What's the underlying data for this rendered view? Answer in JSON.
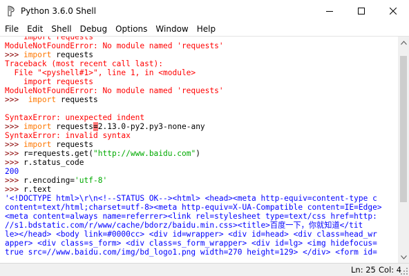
{
  "window": {
    "title": "Python 3.6.0 Shell",
    "icon": "idle-feather-icon"
  },
  "menu": [
    "File",
    "Edit",
    "Shell",
    "Debug",
    "Options",
    "Window",
    "Help"
  ],
  "colors": {
    "error": "#ff0000",
    "keyword": "#ff7700",
    "prompt": "#8b0000",
    "output": "#0000ff",
    "string": "#00aa00",
    "error_highlight": "#ff7777"
  },
  "shell_lines": [
    [
      {
        "t": "    ",
        "c": "black"
      },
      {
        "t": "import",
        "c": "err"
      },
      {
        "t": " requests",
        "c": "err"
      }
    ],
    [
      {
        "t": "ModuleNotFoundError: No module named 'requests'",
        "c": "err"
      }
    ],
    [
      {
        "t": ">>> ",
        "c": "prompt"
      },
      {
        "t": "import",
        "c": "kw"
      },
      {
        "t": " requests",
        "c": "black"
      }
    ],
    [
      {
        "t": "Traceback (most recent call last):",
        "c": "err"
      }
    ],
    [
      {
        "t": "  File \"<pyshell#1>\", line 1, in <module>",
        "c": "err"
      }
    ],
    [
      {
        "t": "    import requests",
        "c": "err"
      }
    ],
    [
      {
        "t": "ModuleNotFoundError: No module named 'requests'",
        "c": "err"
      }
    ],
    [
      {
        "t": ">>>  ",
        "c": "prompt"
      },
      {
        "t": "import",
        "c": "kw"
      },
      {
        "t": " requests",
        "c": "black"
      }
    ],
    [
      {
        "t": "",
        "c": "black"
      }
    ],
    [
      {
        "t": "SyntaxError: unexpected indent",
        "c": "err"
      }
    ],
    [
      {
        "t": ">>> ",
        "c": "prompt"
      },
      {
        "t": "import",
        "c": "kw"
      },
      {
        "t": " requests",
        "c": "black"
      },
      {
        "t": "=",
        "c": "hl"
      },
      {
        "t": "2.13.0-py2.py3-none-any",
        "c": "black"
      }
    ],
    [
      {
        "t": "SyntaxError: invalid syntax",
        "c": "err"
      }
    ],
    [
      {
        "t": ">>> ",
        "c": "prompt"
      },
      {
        "t": "import",
        "c": "kw"
      },
      {
        "t": " requests",
        "c": "black"
      }
    ],
    [
      {
        "t": ">>> ",
        "c": "prompt"
      },
      {
        "t": "r=requests.get(",
        "c": "black"
      },
      {
        "t": "\"http://www.baidu.com\"",
        "c": "str"
      },
      {
        "t": ")",
        "c": "black"
      }
    ],
    [
      {
        "t": ">>> ",
        "c": "prompt"
      },
      {
        "t": "r.status_code",
        "c": "black"
      }
    ],
    [
      {
        "t": "200",
        "c": "out"
      }
    ],
    [
      {
        "t": ">>> ",
        "c": "prompt"
      },
      {
        "t": "r.encoding=",
        "c": "black"
      },
      {
        "t": "'utf-8'",
        "c": "str"
      }
    ],
    [
      {
        "t": ">>> ",
        "c": "prompt"
      },
      {
        "t": "r.text",
        "c": "black"
      }
    ],
    [
      {
        "t": "'<!DOCTYPE html>\\r\\n<!--STATUS OK--><html> <head><meta http-equiv=content-type c",
        "c": "out"
      }
    ],
    [
      {
        "t": "content=text/html;charset=utf-8><meta http-equiv=X-UA-Compatible content=IE=Edge>",
        "c": "out"
      }
    ],
    [
      {
        "t": "<meta content=always name=referrer><link rel=stylesheet type=text/css href=http:",
        "c": "out"
      }
    ],
    [
      {
        "t": "//s1.bdstatic.com/r/www/cache/bdorz/baidu.min.css><title>百度一下，你就知道</tit",
        "c": "out"
      }
    ],
    [
      {
        "t": "le></head> <body link=#0000cc> <div id=wrapper> <div id=head> <div class=head_wr",
        "c": "out"
      }
    ],
    [
      {
        "t": "apper> <div class=s_form> <div class=s_form_wrapper> <div id=lg> <img hidefocus=",
        "c": "out"
      }
    ],
    [
      {
        "t": "true src=//www.baidu.com/img/bd_logo1.png width=270 height=129> </div> <form id=",
        "c": "out"
      }
    ]
  ],
  "status": {
    "ln": "Ln: 25",
    "col": "Col: 4"
  }
}
